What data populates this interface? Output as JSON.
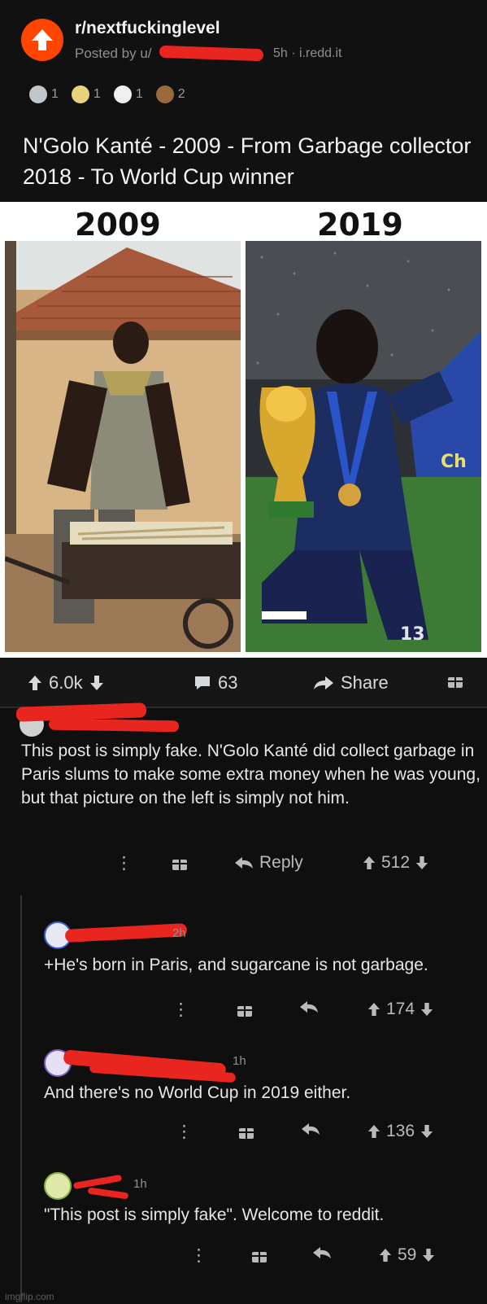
{
  "post": {
    "subreddit": "r/nextfuckinglevel",
    "posted_by": "Posted by u/",
    "time_source": "5h · i.redd.it",
    "awards": [
      {
        "icon": "silver-award-icon",
        "count": "1",
        "color": "#c0c6cc"
      },
      {
        "icon": "wholesome-award-icon",
        "count": "1",
        "color": "#e8d27a"
      },
      {
        "icon": "helpful-award-icon",
        "count": "1",
        "color": "#f0f0f0"
      },
      {
        "icon": "poop-award-icon",
        "count": "2",
        "color": "#9a6a3c"
      }
    ],
    "title": "N'Golo Kanté - 2009 - From Garbage collector 2018 - To World Cup winner",
    "image": {
      "left_year": "2009",
      "right_year": "2019",
      "jersey_text": "Ch",
      "number_text": "13"
    },
    "votes": "6.0k",
    "comments": "63",
    "share": "Share"
  },
  "comments": [
    {
      "text": "This post is simply fake. N'Golo Kanté did collect garbage in Paris slums to make some extra money when he was young, but that picture on the left is simply not him.",
      "reply": "Reply",
      "votes": "512"
    },
    {
      "meta": "2h",
      "text": "+He's born in Paris, and sugarcane is not garbage.",
      "votes": "174"
    },
    {
      "meta": "1h",
      "text": "And there's no World Cup in 2019 either.",
      "votes": "136"
    },
    {
      "meta": "1h",
      "text": "\"This post is simply fake\". Welcome to reddit.",
      "votes": "59"
    }
  ],
  "watermark": "imgflip.com",
  "colors": {
    "accent": "#ff4500",
    "redaction": "#e8261f",
    "background": "#0f0f10"
  }
}
